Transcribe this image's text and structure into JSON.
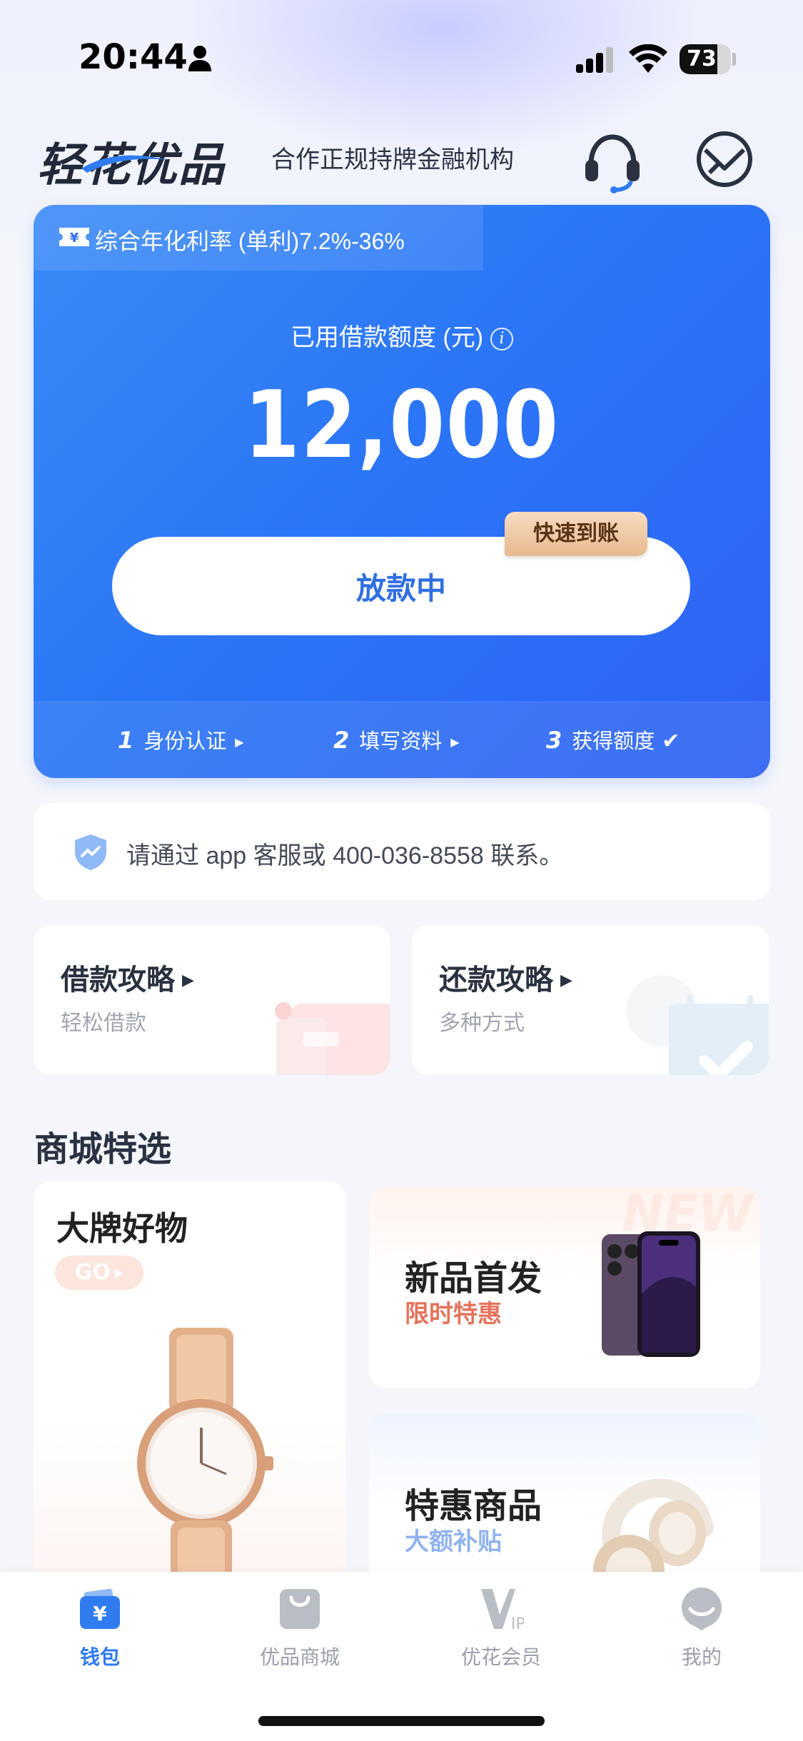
{
  "status_bar": {
    "time": "20:44",
    "battery": "73",
    "battery_level": 0.73
  },
  "header": {
    "logo": "轻花优品",
    "tagline": "合作正规持牌金融机构",
    "icons": [
      "headset-icon",
      "message-icon"
    ]
  },
  "loan_card": {
    "rate_text": "综合年化利率 (单利)7.2%-36%",
    "used_label": "已用借款额度 (元)",
    "info_glyph": "i",
    "amount": "12,000",
    "button_label": "放款中",
    "badge": "快速到账",
    "steps": [
      {
        "num": "1",
        "label": "身份认证",
        "mark": "▶"
      },
      {
        "num": "2",
        "label": "填写资料",
        "mark": "▶"
      },
      {
        "num": "3",
        "label": "获得额度",
        "mark": "✔"
      }
    ]
  },
  "notice": {
    "text": "请通过 app 客服或 400-036-8558 联系。"
  },
  "guides": [
    {
      "title": "借款攻略",
      "subtitle": "轻松借款"
    },
    {
      "title": "还款攻略",
      "subtitle": "多种方式"
    }
  ],
  "mall": {
    "title": "商城特选",
    "brand": {
      "title": "大牌好物",
      "cta": "GO"
    },
    "promos": [
      {
        "title": "新品首发",
        "subtitle": "限时特惠",
        "watermark": "NEW"
      },
      {
        "title": "特惠商品",
        "subtitle": "大额补贴"
      }
    ]
  },
  "tab_bar": {
    "tabs": [
      {
        "label": "钱包",
        "icon": "wallet-icon",
        "active": true
      },
      {
        "label": "优品商城",
        "icon": "shopping-bag-icon",
        "active": false
      },
      {
        "label": "优花会员",
        "icon": "vip-icon",
        "active": false
      },
      {
        "label": "我的",
        "icon": "profile-icon",
        "active": false
      }
    ]
  },
  "colors": {
    "primary_blue": "#2f6ff5",
    "badge_gold": "#e7b98e",
    "accent_red": "#e5735a"
  }
}
